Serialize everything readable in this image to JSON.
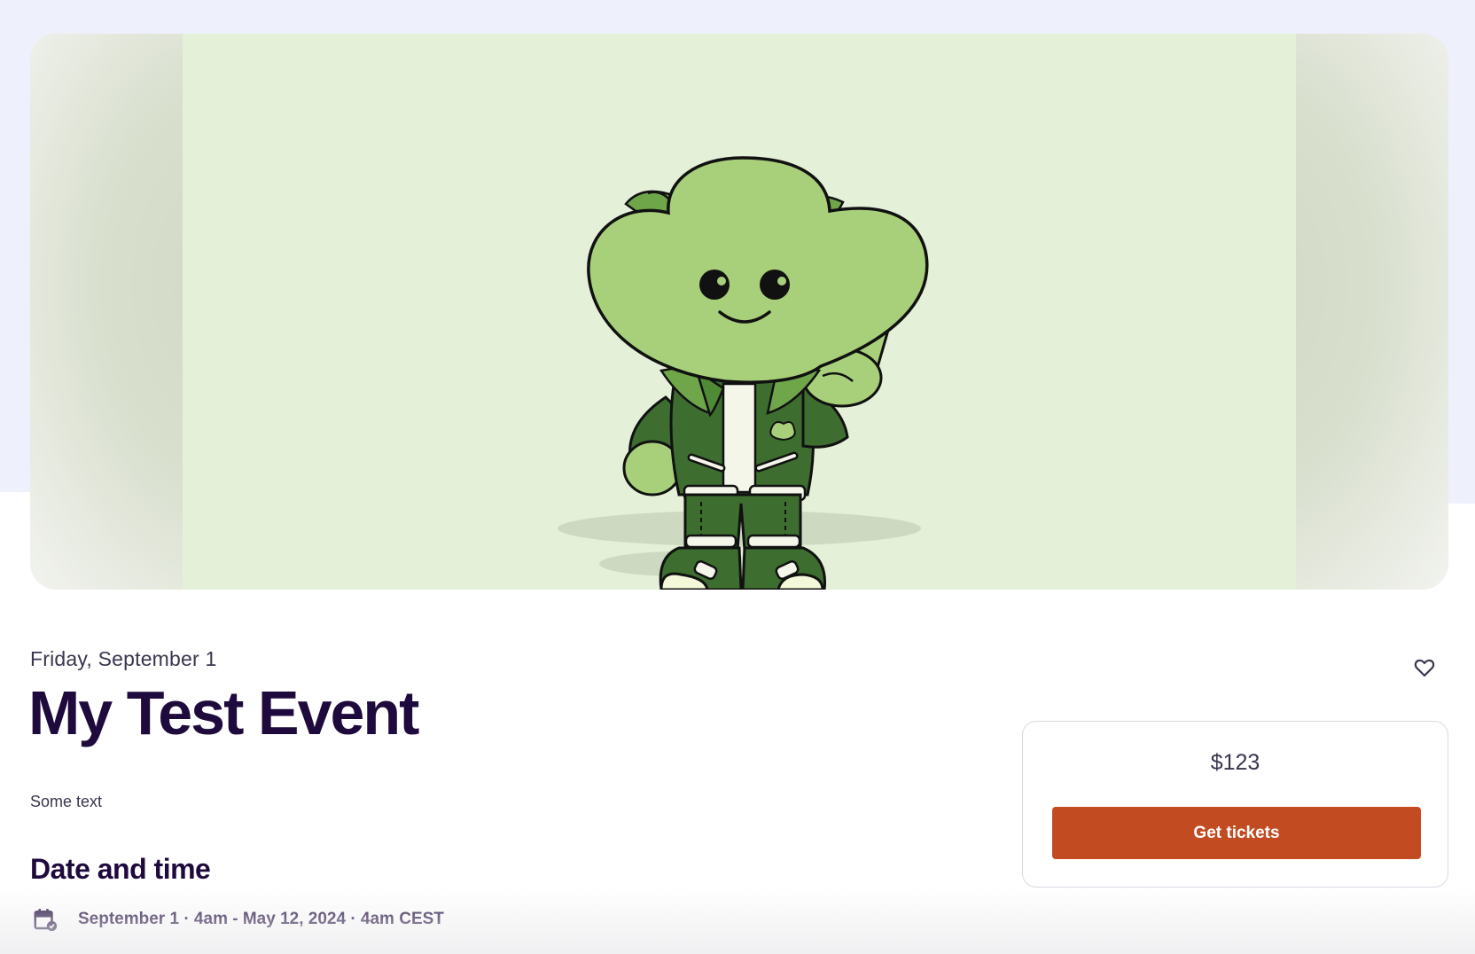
{
  "hero": {
    "image_alt": "Green cartoon mascot making a peace sign",
    "colors": {
      "background": "#e4f0d7",
      "mascot_light": "#a8d07a",
      "mascot_dark": "#3d6e2f"
    }
  },
  "event": {
    "date_label": "Friday, September 1",
    "title": "My Test Event",
    "summary": "Some text",
    "date_time_heading": "Date and time",
    "date_time_range": "September 1 · 4am - May 12, 2024 · 4am CEST"
  },
  "ticket": {
    "price": "$123",
    "button_label": "Get tickets",
    "button_color": "#c24b21"
  },
  "icons": {
    "favorite": "heart-icon",
    "calendar": "calendar-icon"
  }
}
